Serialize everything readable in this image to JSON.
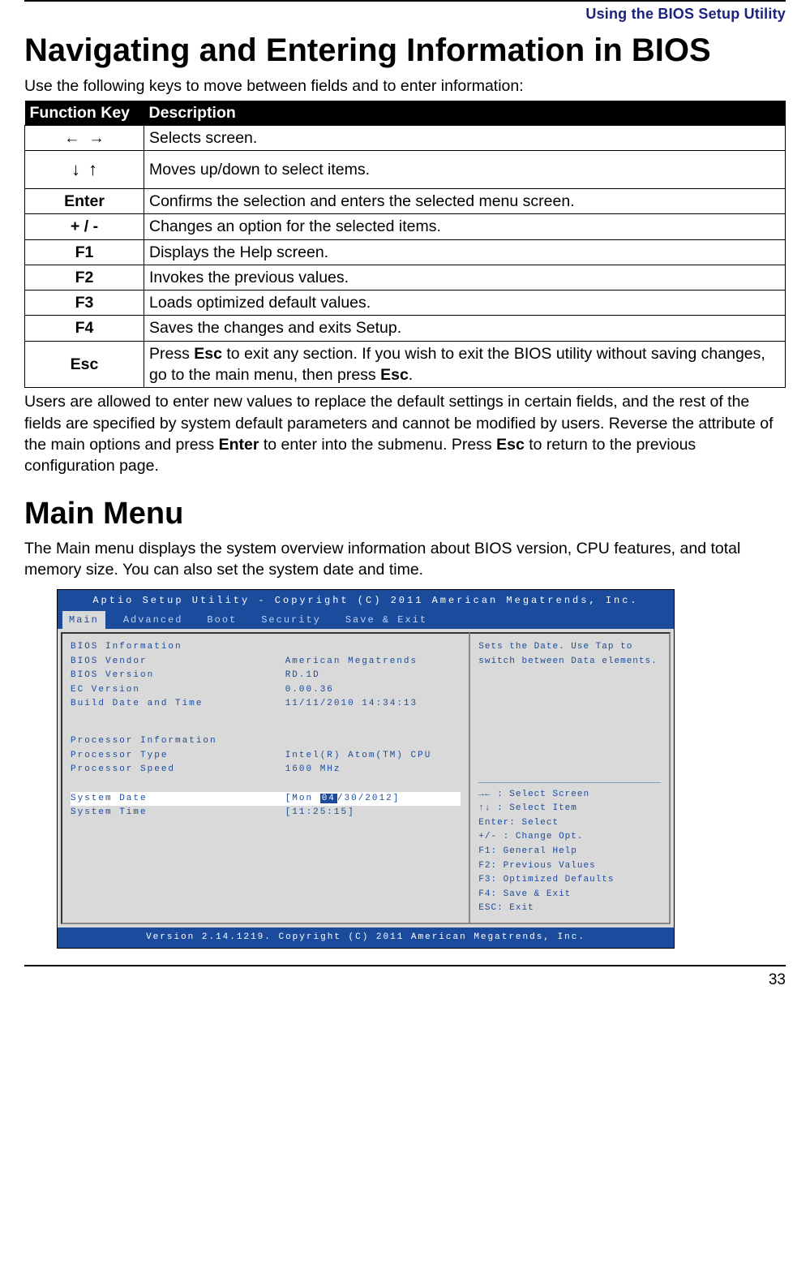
{
  "header": {
    "title": "Using the BIOS Setup Utility"
  },
  "section1": {
    "heading": "Navigating and Entering Information in BIOS",
    "intro": "Use the following keys to move between fields and to enter information:",
    "table": {
      "headers": [
        "Function Key",
        "Description"
      ],
      "rows": [
        {
          "key_html": "←  →",
          "desc": "Selects screen."
        },
        {
          "key_html": "↓  ↑",
          "desc": "Moves up/down to select items.",
          "tall": true
        },
        {
          "key_html": "Enter",
          "desc": "Confirms the selection and enters the selected menu screen."
        },
        {
          "key_html": "+ / -",
          "desc": "Changes an option for the selected items."
        },
        {
          "key_html": "F1",
          "desc": "Displays the Help screen."
        },
        {
          "key_html": "F2",
          "desc": "Invokes the previous values."
        },
        {
          "key_html": "F3",
          "desc": "Loads optimized default values."
        },
        {
          "key_html": "F4",
          "desc": "Saves the changes and exits Setup."
        },
        {
          "key_html": "Esc",
          "desc_html": "Press <b>Esc</b> to exit any section. If you wish to exit the BIOS utility without saving changes, go to the main menu, then press <b>Esc</b>."
        }
      ]
    },
    "body_html": "Users are allowed to enter new values to replace the default settings in certain fields, and the rest of the fields are specified by system default parameters and cannot be modified by users. Reverse the attribute of the main options and press <b>Enter</b> to enter into the submenu. Press <b>Esc</b> to return to the previous configuration page."
  },
  "section2": {
    "heading": "Main Menu",
    "intro": "The Main menu displays the system overview information about BIOS version, CPU features, and total memory size. You can also set the system date and time."
  },
  "bios": {
    "titlebar": "Aptio Setup Utility - Copyright (C) 2011 American Megatrends, Inc.",
    "tabs": [
      "Main",
      "Advanced",
      "Boot",
      "Security",
      "Save & Exit"
    ],
    "active_tab": 0,
    "left": {
      "bios_info_title": "BIOS Information",
      "rows1": [
        {
          "label": "BIOS Vendor",
          "value": "American Megatrends"
        },
        {
          "label": "BIOS Version",
          "value": "RD.1D"
        },
        {
          "label": "EC Version",
          "value": "0.00.36"
        },
        {
          "label": "Build Date and Time",
          "value": "11/11/2010 14:34:13"
        }
      ],
      "proc_info_title": "Processor Information",
      "rows2": [
        {
          "label": "Processor Type",
          "value": "Intel(R) Atom(TM) CPU"
        },
        {
          "label": "Processor Speed",
          "value": "1600 MHz"
        }
      ],
      "date_row": {
        "label": "System Date",
        "prefix": "[Mon ",
        "hl": "04",
        "suffix": "/30/2012]"
      },
      "time_row": {
        "label": "System Time",
        "value": "[11:25:15]"
      }
    },
    "right": {
      "help_top": "Sets the Date. Use Tap to switch between Data elements.",
      "help_bottom": [
        "→← : Select Screen",
        "↑↓ : Select Item",
        "Enter: Select",
        "+/- : Change Opt.",
        "F1: General Help",
        "F2: Previous Values",
        "F3: Optimized Defaults",
        "F4: Save & Exit",
        "ESC: Exit"
      ]
    },
    "footer": "Version 2.14.1219. Copyright (C) 2011 American Megatrends, Inc."
  },
  "page_number": "33"
}
